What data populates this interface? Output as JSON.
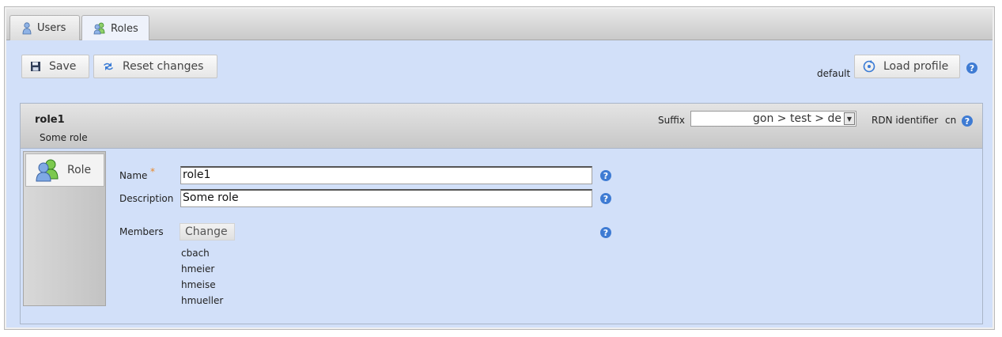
{
  "tabs": [
    {
      "label": "Users",
      "icon": "user-icon"
    },
    {
      "label": "Roles",
      "icon": "roles-icon"
    }
  ],
  "toolbar": {
    "save_label": "Save",
    "reset_label": "Reset changes",
    "profile_name": "default",
    "load_profile_label": "Load profile"
  },
  "record": {
    "title": "role1",
    "subtitle": "Some role",
    "suffix_label": "Suffix",
    "suffix_value": "gon > test > de",
    "rdn_label": "RDN identifier",
    "rdn_value": "cn"
  },
  "side_tabs": [
    {
      "label": "Role",
      "icon": "role-group-icon"
    }
  ],
  "form": {
    "name_label": "Name",
    "required_marker": "*",
    "name_value": "role1",
    "description_label": "Description",
    "description_value": "Some role",
    "members_label": "Members",
    "change_label": "Change",
    "members": [
      "cbach",
      "hmeier",
      "hmeise",
      "hmueller"
    ]
  },
  "help_glyph": "?",
  "colors": {
    "content_bg": "#d2e0f9",
    "help_blue": "#3e7bd3",
    "required_orange": "#e8872a"
  }
}
